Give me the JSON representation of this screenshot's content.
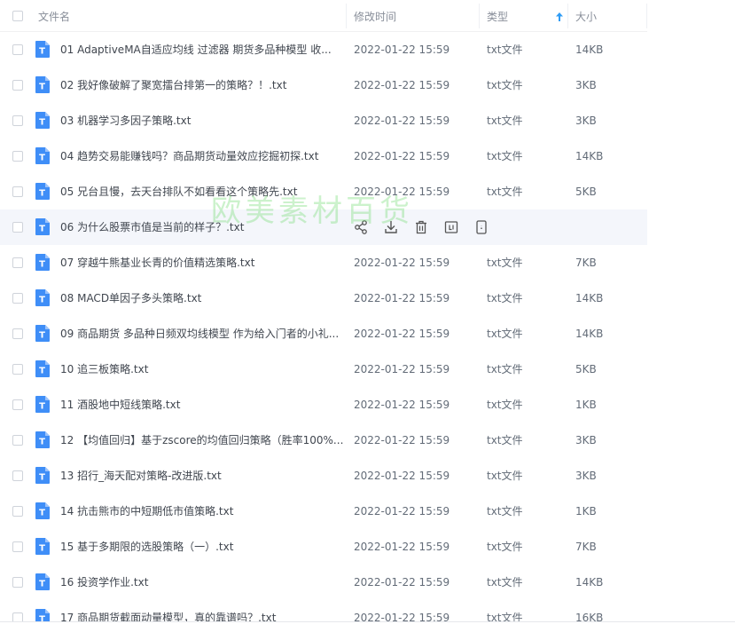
{
  "header": {
    "name_label": "文件名",
    "time_label": "修改时间",
    "type_label": "类型",
    "size_label": "大小",
    "sorted_column": "类型",
    "sort_direction": "ascending"
  },
  "files": [
    {
      "name": "01 AdaptiveMA自适应均线 过滤器 期货多品种模型 收...",
      "time": "2022-01-22 15:59",
      "type": "txt文件",
      "size": "14KB"
    },
    {
      "name": "02 我好像破解了聚宽擂台排第一的策略？！.txt",
      "time": "2022-01-22 15:59",
      "type": "txt文件",
      "size": "3KB"
    },
    {
      "name": "03 机器学习多因子策略.txt",
      "time": "2022-01-22 15:59",
      "type": "txt文件",
      "size": "3KB"
    },
    {
      "name": "04 趋势交易能赚钱吗？商品期货动量效应挖掘初探.txt",
      "time": "2022-01-22 15:59",
      "type": "txt文件",
      "size": "14KB"
    },
    {
      "name": "05 兄台且慢，去天台排队不如看看这个策略先.txt",
      "time": "2022-01-22 15:59",
      "type": "txt文件",
      "size": "5KB"
    },
    {
      "name": "06 为什么股票市值是当前的样子？.txt",
      "time": "",
      "type": "",
      "size": "",
      "hovered": true
    },
    {
      "name": "07 穿越牛熊基业长青的价值精选策略.txt",
      "time": "2022-01-22 15:59",
      "type": "txt文件",
      "size": "7KB"
    },
    {
      "name": "08 MACD单因子多头策略.txt",
      "time": "2022-01-22 15:59",
      "type": "txt文件",
      "size": "14KB"
    },
    {
      "name": "09 商品期货 多品种日频双均线模型 作为给入门者的小礼...",
      "time": "2022-01-22 15:59",
      "type": "txt文件",
      "size": "14KB"
    },
    {
      "name": "10 追三板策略.txt",
      "time": "2022-01-22 15:59",
      "type": "txt文件",
      "size": "5KB"
    },
    {
      "name": "11 酒股地中短线策略.txt",
      "time": "2022-01-22 15:59",
      "type": "txt文件",
      "size": "1KB"
    },
    {
      "name": "12 【均值回归】基于zscore的均值回归策略（胜率100%...",
      "time": "2022-01-22 15:59",
      "type": "txt文件",
      "size": "3KB"
    },
    {
      "name": "13 招行_海天配对策略-改进版.txt",
      "time": "2022-01-22 15:59",
      "type": "txt文件",
      "size": "3KB"
    },
    {
      "name": "14 抗击熊市的中短期低市值策略.txt",
      "time": "2022-01-22 15:59",
      "type": "txt文件",
      "size": "1KB"
    },
    {
      "name": "15 基于多期限的选股策略（一）.txt",
      "time": "2022-01-22 15:59",
      "type": "txt文件",
      "size": "7KB"
    },
    {
      "name": "16 投资学作业.txt",
      "time": "2022-01-22 15:59",
      "type": "txt文件",
      "size": "14KB"
    },
    {
      "name": "17 商品期货截面动量模型，真的靠谱吗？.txt",
      "time": "2022-01-22 15:59",
      "type": "txt文件",
      "size": "16KB"
    }
  ],
  "file_icon": {
    "name": "txt-file-icon",
    "letter": "T",
    "color": "#3f8ef7"
  },
  "row_actions": [
    "share-icon",
    "download-icon",
    "delete-icon",
    "rename-icon",
    "more-icon"
  ],
  "watermark": "欧美素材百货",
  "colors": {
    "accent": "#3f8ef7",
    "hover_row": "#f4f6fb",
    "sort_arrow": "#2f9cf5"
  }
}
